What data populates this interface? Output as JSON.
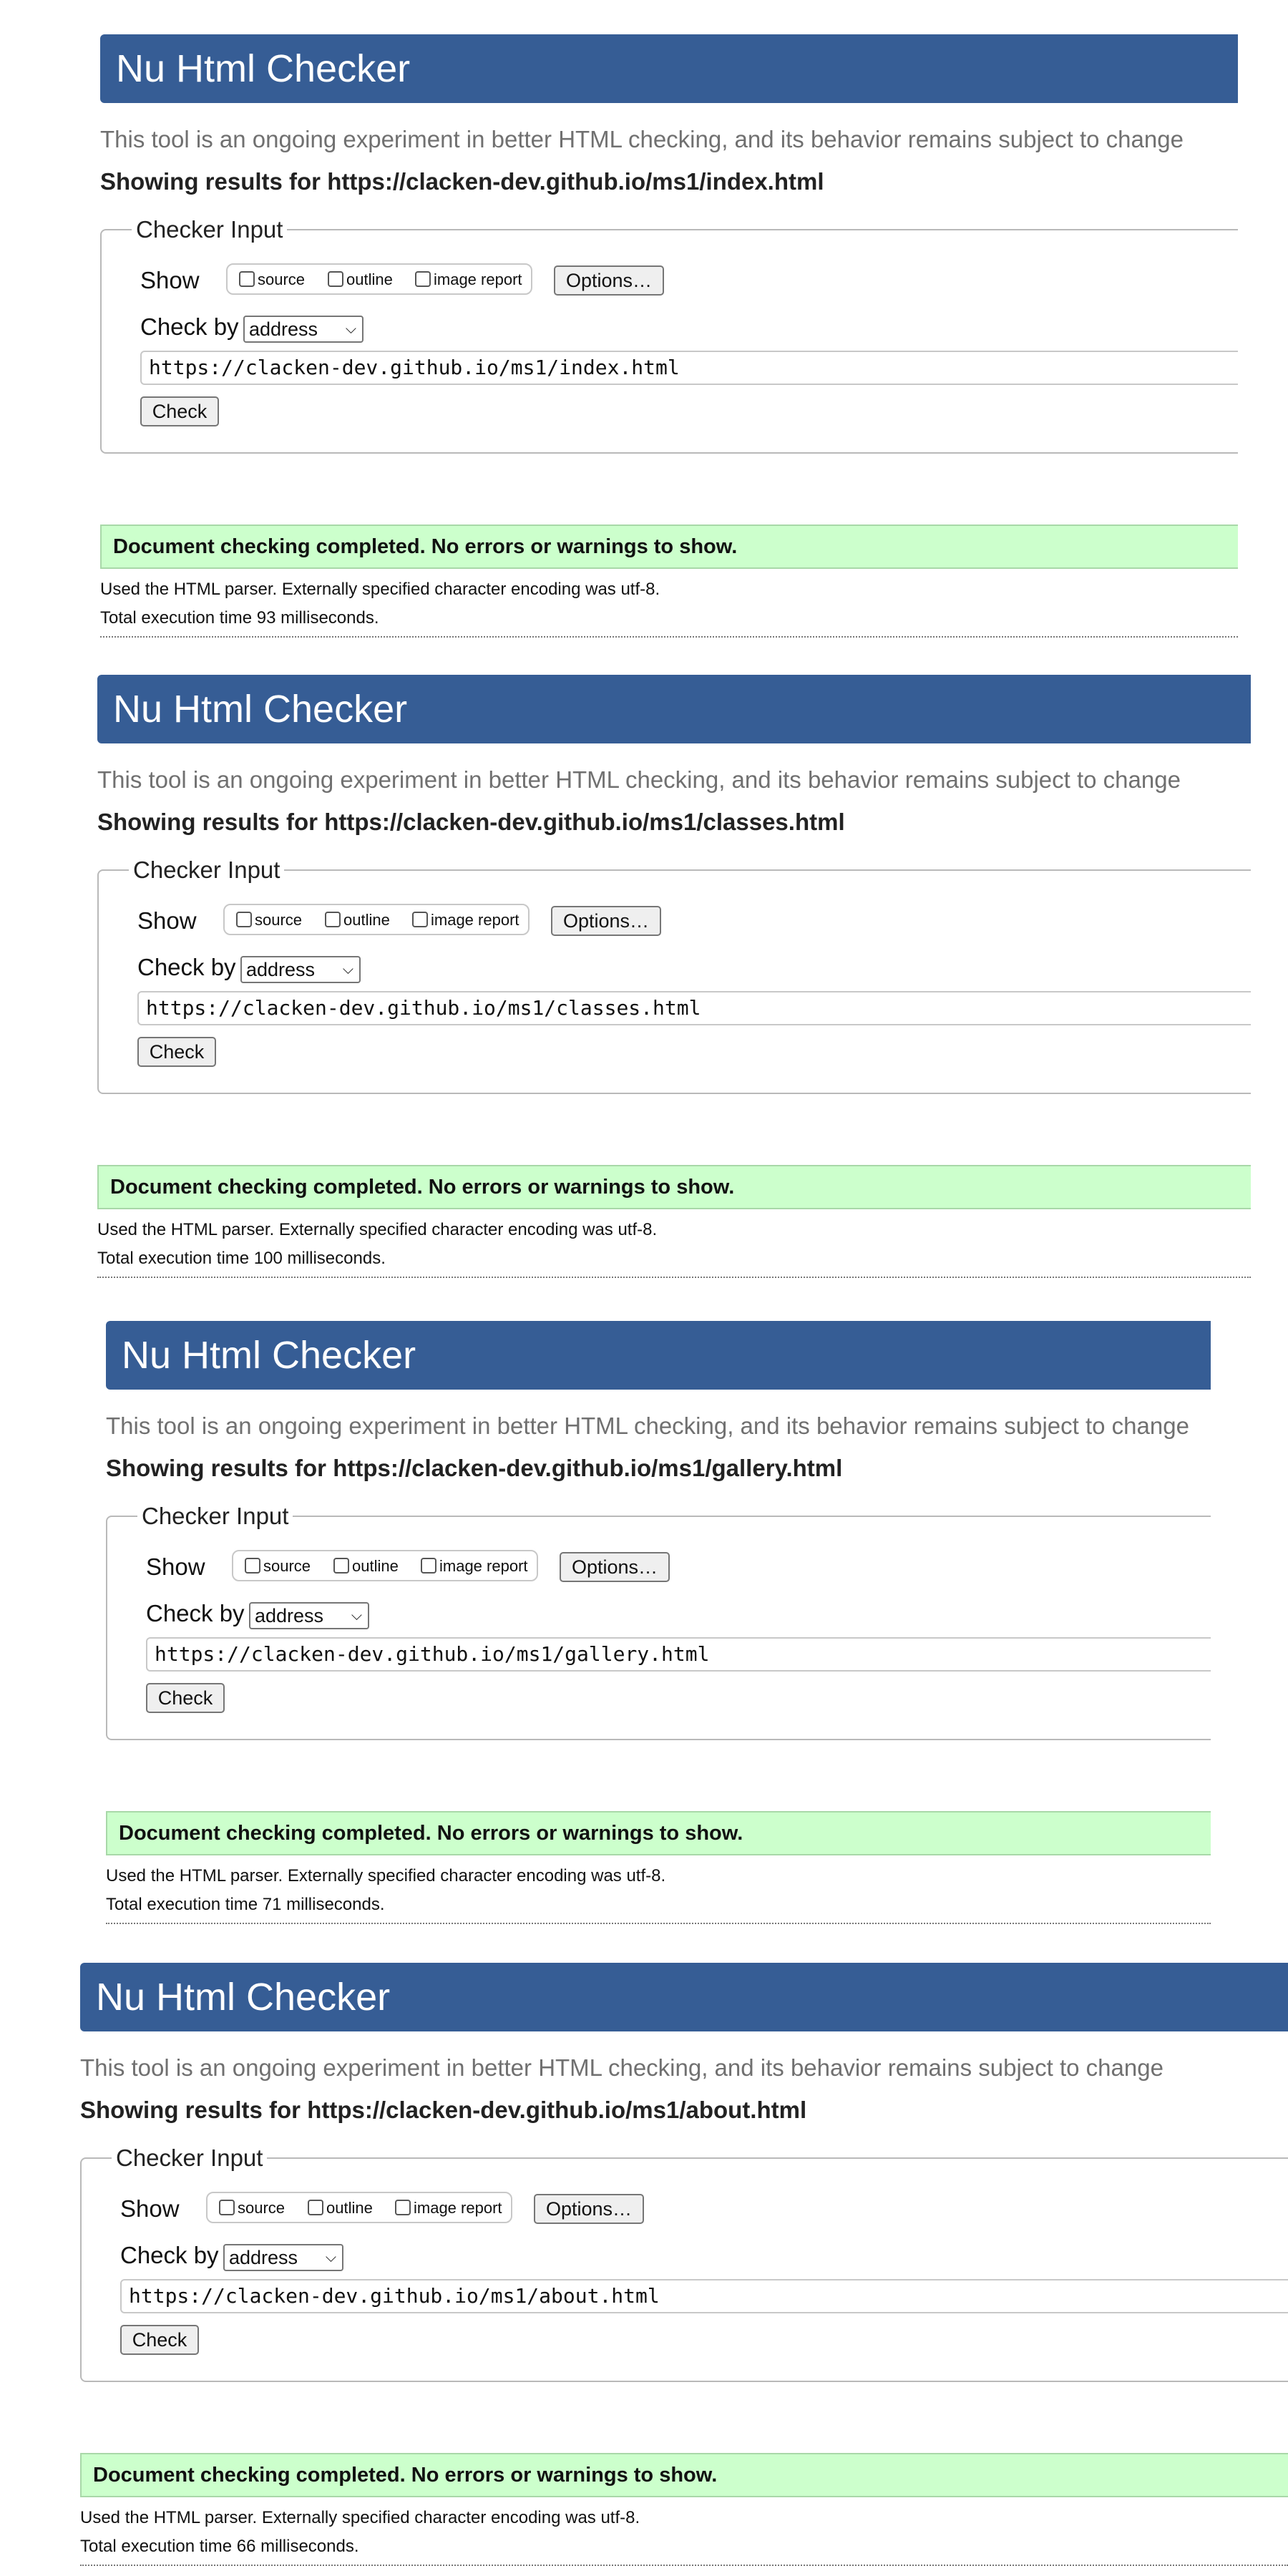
{
  "reports": [
    {
      "title": "Nu Html Checker",
      "subtitle": "This tool is an ongoing experiment in better HTML checking, and its behavior remains subject to change",
      "results_for": "Showing results for https://clacken-dev.github.io/ms1/index.html",
      "legend": "Checker Input",
      "show_label": "Show",
      "options": [
        "source",
        "outline",
        "image report"
      ],
      "options_button": "Options…",
      "check_by_label": "Check by",
      "check_by_value": "address",
      "url": "https://clacken-dev.github.io/ms1/index.html",
      "check_button": "Check",
      "status": "Document checking completed. No errors or warnings to show.",
      "parser_info": "Used the HTML parser. Externally specified character encoding was utf-8.",
      "execution_time": "Total execution time 93 milliseconds."
    },
    {
      "title": "Nu Html Checker",
      "subtitle": "This tool is an ongoing experiment in better HTML checking, and its behavior remains subject to change",
      "results_for": "Showing results for https://clacken-dev.github.io/ms1/classes.html",
      "legend": "Checker Input",
      "show_label": "Show",
      "options": [
        "source",
        "outline",
        "image report"
      ],
      "options_button": "Options…",
      "check_by_label": "Check by",
      "check_by_value": "address",
      "url": "https://clacken-dev.github.io/ms1/classes.html",
      "check_button": "Check",
      "status": "Document checking completed. No errors or warnings to show.",
      "parser_info": "Used the HTML parser. Externally specified character encoding was utf-8.",
      "execution_time": "Total execution time 100 milliseconds."
    },
    {
      "title": "Nu Html Checker",
      "subtitle": "This tool is an ongoing experiment in better HTML checking, and its behavior remains subject to change",
      "results_for": "Showing results for https://clacken-dev.github.io/ms1/gallery.html",
      "legend": "Checker Input",
      "show_label": "Show",
      "options": [
        "source",
        "outline",
        "image report"
      ],
      "options_button": "Options…",
      "check_by_label": "Check by",
      "check_by_value": "address",
      "url": "https://clacken-dev.github.io/ms1/gallery.html",
      "check_button": "Check",
      "status": "Document checking completed. No errors or warnings to show.",
      "parser_info": "Used the HTML parser. Externally specified character encoding was utf-8.",
      "execution_time": "Total execution time 71 milliseconds."
    },
    {
      "title": "Nu Html Checker",
      "subtitle": "This tool is an ongoing experiment in better HTML checking, and its behavior remains subject to change",
      "results_for": "Showing results for https://clacken-dev.github.io/ms1/about.html",
      "legend": "Checker Input",
      "show_label": "Show",
      "options": [
        "source",
        "outline",
        "image report"
      ],
      "options_button": "Options…",
      "check_by_label": "Check by",
      "check_by_value": "address",
      "url": "https://clacken-dev.github.io/ms1/about.html",
      "check_button": "Check",
      "status": "Document checking completed. No errors or warnings to show.",
      "parser_info": "Used the HTML parser. Externally specified character encoding was utf-8.",
      "execution_time": "Total execution time 66 milliseconds."
    }
  ],
  "colors": {
    "banner": "#365d95",
    "success_bg": "#ccffcc",
    "subtitle": "#707070"
  }
}
